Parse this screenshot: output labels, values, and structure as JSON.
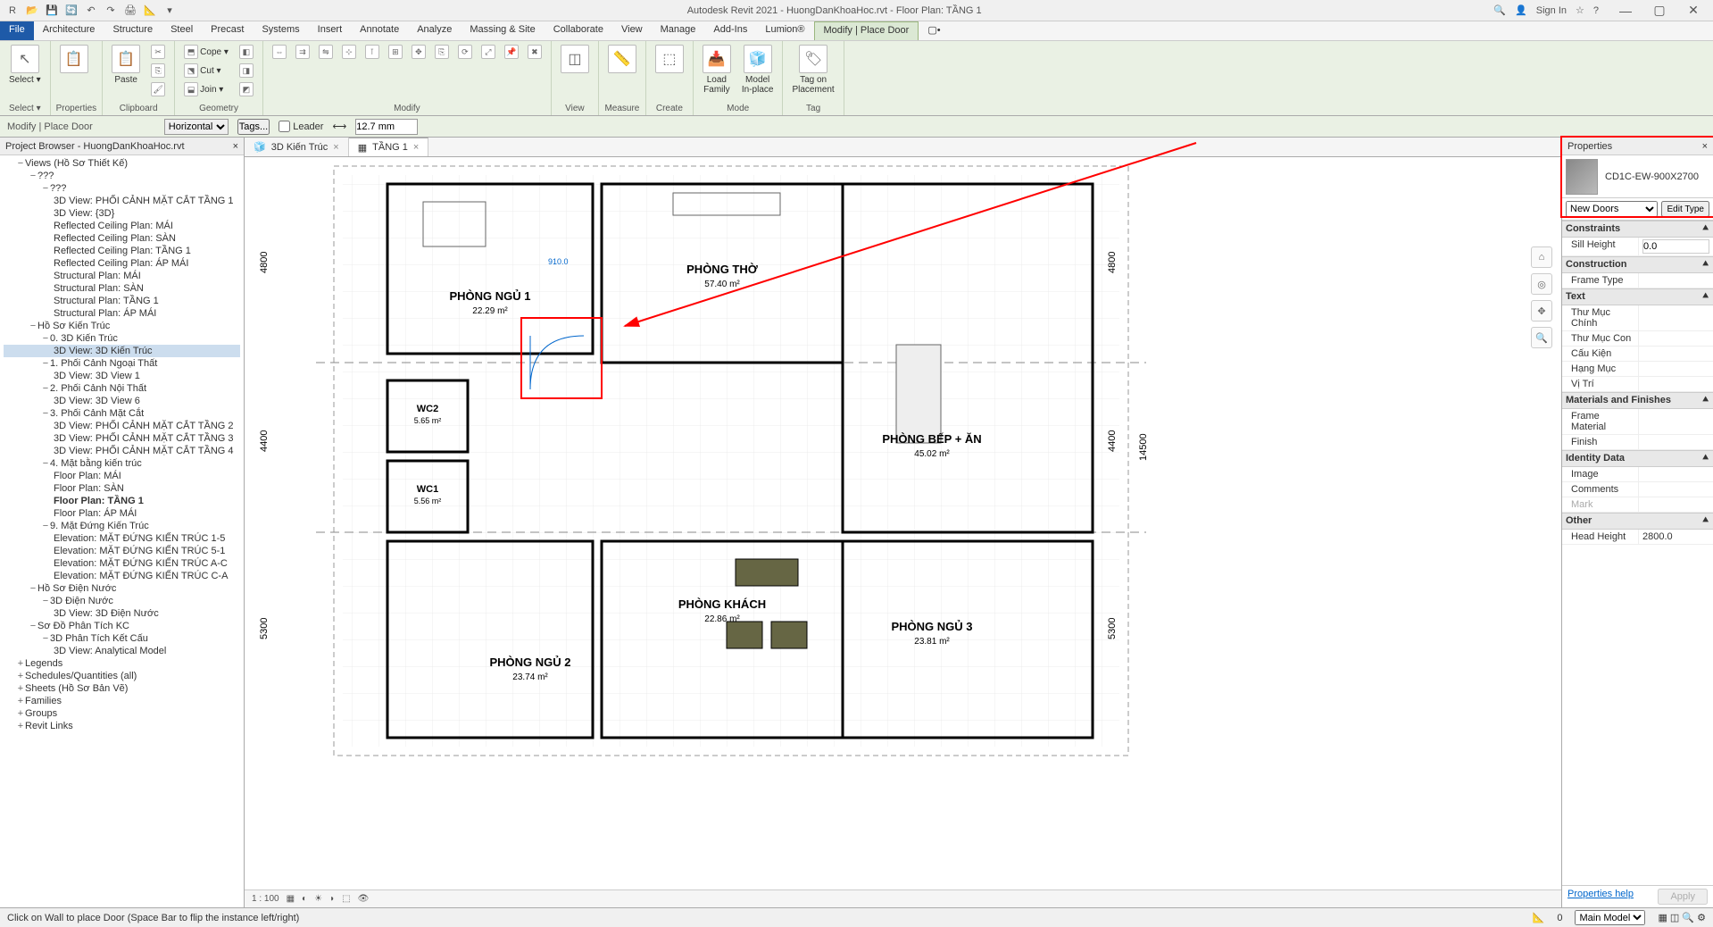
{
  "titlebar": {
    "title": "Autodesk Revit 2021 - HuongDanKhoaHoc.rvt - Floor Plan: TẦNG 1",
    "signin": "Sign In"
  },
  "menus": {
    "file": "File",
    "arch": "Architecture",
    "struct": "Structure",
    "steel": "Steel",
    "precast": "Precast",
    "systems": "Systems",
    "insert": "Insert",
    "annotate": "Annotate",
    "analyze": "Analyze",
    "massing": "Massing & Site",
    "collab": "Collaborate",
    "view": "View",
    "manage": "Manage",
    "addins": "Add-Ins",
    "lumion": "Lumion®",
    "modify": "Modify | Place Door",
    "extra": "▢•"
  },
  "ribbon": {
    "select": "Select ▾",
    "properties": "Properties",
    "clipboard": "Clipboard",
    "geometry": "Geometry",
    "modify": "Modify",
    "view": "View",
    "measure": "Measure",
    "create": "Create",
    "mode": "Mode",
    "tag": "Tag",
    "paste": "Paste",
    "cope": "Cope ▾",
    "cut": "Cut ▾",
    "join": "Join ▾",
    "loadfam": "Load\nFamily",
    "inplace": "Model\nIn-place",
    "tagon": "Tag on\nPlacement"
  },
  "optbar": {
    "context": "Modify | Place Door",
    "orient": "Horizontal",
    "tags": "Tags...",
    "leader": "Leader",
    "offset": "12.7 mm"
  },
  "browser": {
    "title": "Project Browser - HuongDanKhoaHoc.rvt",
    "views": "Views (Hồ Sơ Thiết Kế)",
    "q1": "???",
    "q2": "???",
    "v1": "3D View: PHỐI CẢNH MẶT CẮT TẦNG 1",
    "v2": "3D View: {3D}",
    "v3": "Reflected Ceiling Plan: MÁI",
    "v4": "Reflected Ceiling Plan: SÀN",
    "v5": "Reflected Ceiling Plan: TẦNG 1",
    "v6": "Reflected Ceiling Plan: ÁP MÁI",
    "v7": "Structural Plan: MÁI",
    "v8": "Structural Plan: SÀN",
    "v9": "Structural Plan: TẦNG 1",
    "v10": "Structural Plan: ÁP MÁI",
    "g1": "Hồ Sơ Kiến Trúc",
    "g1a": "0. 3D Kiến Trúc",
    "g1a1": "3D View: 3D Kiến Trúc",
    "g1b": "1. Phối Cảnh Ngoại Thất",
    "g1b1": "3D View: 3D View 1",
    "g1c": "2. Phối Cảnh Nội Thất",
    "g1c1": "3D View: 3D View 6",
    "g1d": "3. Phối Cảnh Mặt Cắt",
    "g1d1": "3D View: PHỐI CẢNH MẶT CẮT TẦNG 2",
    "g1d2": "3D View: PHỐI CẢNH MẶT CẮT TẦNG 3",
    "g1d3": "3D View: PHỐI CẢNH MẶT CẮT TẦNG 4",
    "g1e": "4. Mặt bằng kiến trúc",
    "g1e1": "Floor Plan: MÁI",
    "g1e2": "Floor Plan: SÀN",
    "g1e3": "Floor Plan: TẦNG 1",
    "g1e4": "Floor Plan: ÁP MÁI",
    "g1f": "9. Mặt Đứng Kiến Trúc",
    "g1f1": "Elevation: MẶT ĐỨNG KIẾN TRÚC 1-5",
    "g1f2": "Elevation: MẶT ĐỨNG KIẾN TRÚC 5-1",
    "g1f3": "Elevation: MẶT ĐỨNG KIẾN TRÚC A-C",
    "g1f4": "Elevation: MẶT ĐỨNG KIẾN TRÚC C-A",
    "g2": "Hồ Sơ Điện Nước",
    "g2a": "3D Điện Nước",
    "g2a1": "3D View: 3D Điện Nước",
    "g3": "Sơ Đồ Phân Tích KC",
    "g3a": "3D Phân Tích Kết Cấu",
    "g3a1": "3D View: Analytical Model",
    "legends": "Legends",
    "sched": "Schedules/Quantities (all)",
    "sheets": "Sheets (Hồ Sơ Bản Vẽ)",
    "families": "Families",
    "groups": "Groups",
    "links": "Revit Links"
  },
  "viewtabs": {
    "t1": "3D Kiến Trúc",
    "t2": "TẦNG 1"
  },
  "rooms": {
    "r1": "PHÒNG NGỦ 1",
    "r1a": "22.29 m²",
    "r2": "PHÒNG THỜ",
    "r2a": "57.40 m²",
    "r3": "WC2",
    "r3a": "5.65 m²",
    "r4": "WC1",
    "r4a": "5.56 m²",
    "r5": "PHÒNG BẾP + ĂN",
    "r5a": "45.02 m²",
    "r6": "PHÒNG KHÁCH",
    "r6a": "22.86 m²",
    "r7": "PHÒNG NGỦ 2",
    "r7a": "23.74 m²",
    "r8": "PHÒNG NGỦ 3",
    "r8a": "23.81 m²",
    "dim1": "4800",
    "dim2": "4400",
    "dim3": "5300",
    "dim4": "14500",
    "ddoor": "910.0"
  },
  "props": {
    "title": "Properties",
    "typename": "CD1C-EW-900X2700",
    "selector": "New Doors",
    "edittype": "Edit Type",
    "g_constraints": "Constraints",
    "sill": "Sill Height",
    "sillv": "0.0",
    "g_constr": "Construction",
    "frametype": "Frame Type",
    "g_text": "Text",
    "tmc": "Thư Mục Chính",
    "tmcon": "Thư Mục Con",
    "ck": "Cấu Kiện",
    "hm": "Hạng Mục",
    "vt": "Vị Trí",
    "g_mat": "Materials and Finishes",
    "fmat": "Frame Material",
    "finish": "Finish",
    "g_id": "Identity Data",
    "image": "Image",
    "comments": "Comments",
    "mark": "Mark",
    "g_other": "Other",
    "headh": "Head Height",
    "headhv": "2800.0",
    "help": "Properties help",
    "apply": "Apply"
  },
  "viewbar": {
    "scale": "1 : 100"
  },
  "status": {
    "msg": "Click on Wall to place Door (Space Bar to flip the instance left/right)",
    "zero": "0",
    "model": "Main Model"
  }
}
